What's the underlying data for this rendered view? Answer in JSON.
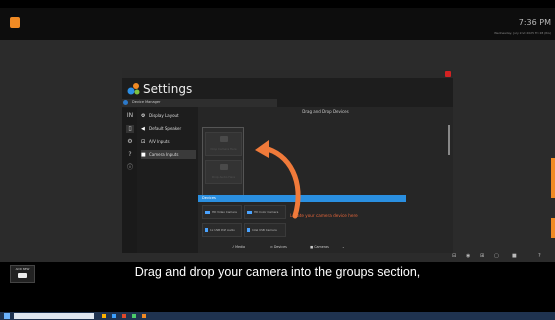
{
  "topbar": {
    "clock": "7:36 PM",
    "subclock": "Wednesday, July 2nd 2025 Fri 28 (RG)"
  },
  "window": {
    "title": "Settings",
    "breadcrumb": "Device Manager",
    "rail_icons": [
      "IN",
      "▯",
      "⚙",
      "?",
      "ⓘ"
    ],
    "menu": [
      {
        "glyph": "⚙",
        "label": "Display Layout"
      },
      {
        "glyph": "◀",
        "label": "Default Speaker"
      },
      {
        "glyph": "⊡",
        "label": "A/V Inputs"
      },
      {
        "glyph": "■",
        "label": "Camera Inputs",
        "active": true
      }
    ],
    "content_title": "Drag and Drop Devices",
    "drop_slots": [
      "Drop Camera Here",
      "Drop Audio Here"
    ],
    "devices_label": "Devices",
    "devices": [
      {
        "label": "HD Video Camera",
        "color": "#4aa3ff"
      },
      {
        "label": "HD Color Camera",
        "color": "#4aa3ff"
      },
      {
        "label": "1x USB PnP Audio",
        "color": "#4aa3ff"
      },
      {
        "label": "Intel USB Camera",
        "color": "#4aa3ff"
      }
    ],
    "hint": "Locate your camera device here"
  },
  "tabs": [
    {
      "glyph": "♪",
      "label": "Media"
    },
    {
      "glyph": "⊙",
      "label": "Devices"
    },
    {
      "glyph": "■",
      "label": "Cameras"
    },
    {
      "glyph": "⌄",
      "label": ""
    }
  ],
  "sys_icons": [
    "⊟",
    "◉",
    "⊞",
    "▢",
    "■",
    "?"
  ],
  "add_new": {
    "label": "ADD NEW"
  },
  "caption": "Drag and drop your camera into the groups section,",
  "colors": {
    "accent": "#2a8fe0",
    "brand": "#f08a24",
    "hint": "#e8663a",
    "arrow": "#f07a3a"
  }
}
